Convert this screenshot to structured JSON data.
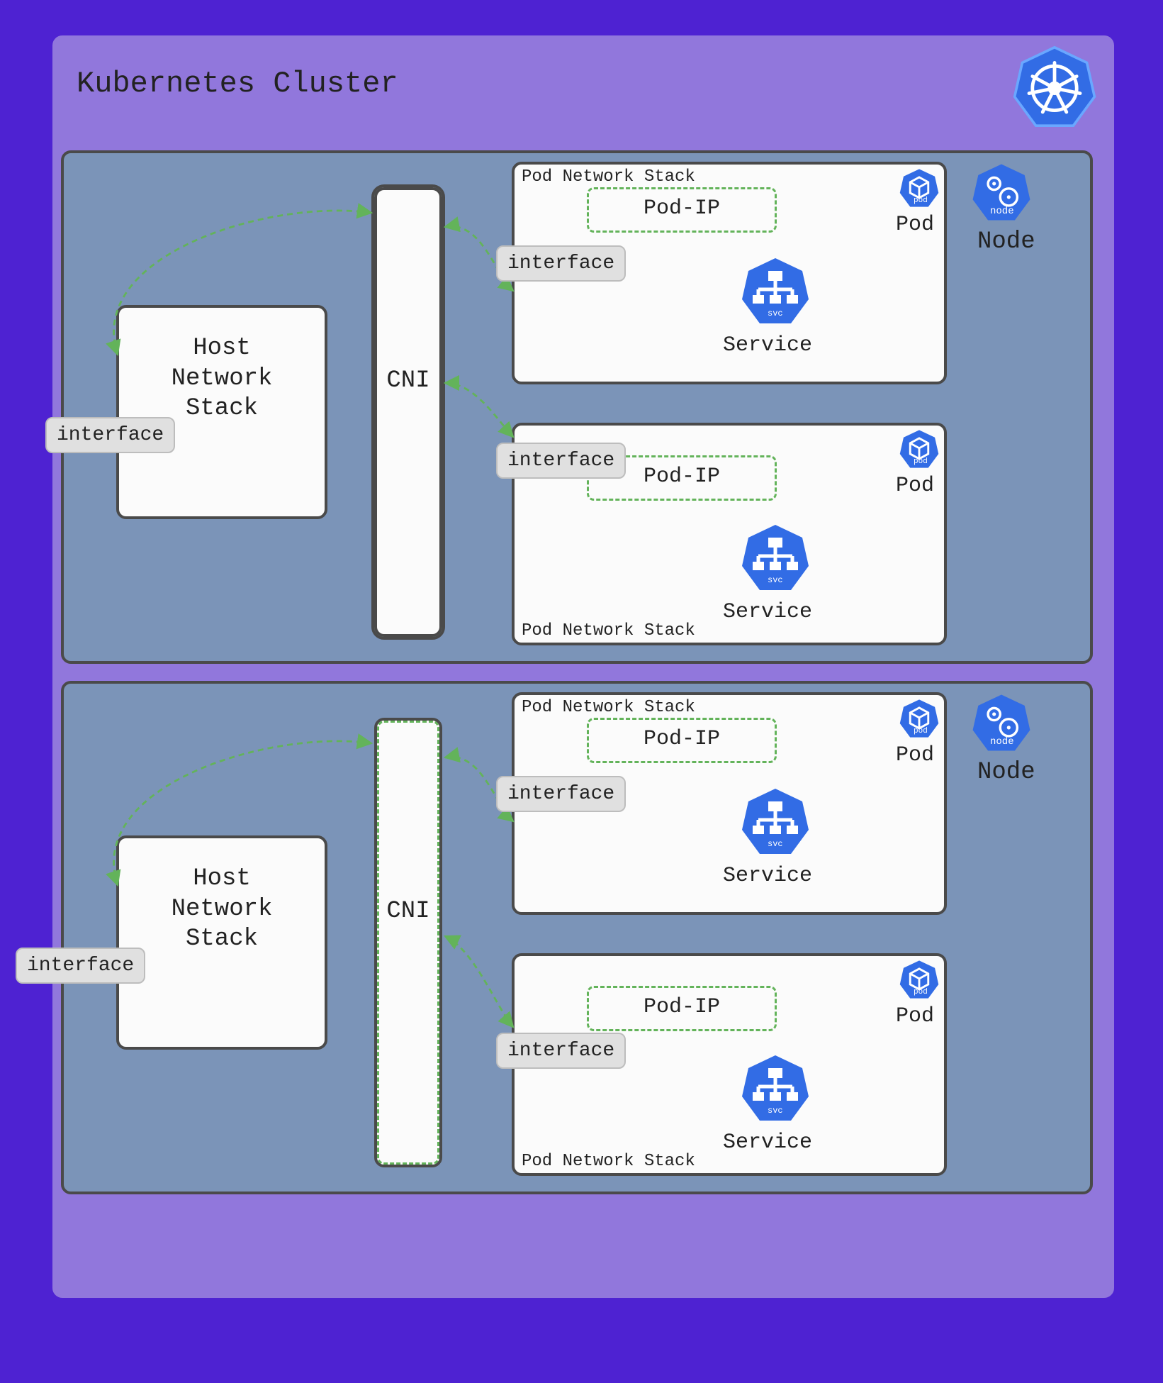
{
  "colors": {
    "bg_outer": "#4e22d2",
    "bg_cluster": "#9177dc",
    "bg_node": "#7b94b8",
    "bg_box": "#fbfbfb",
    "border": "#4a4a4a",
    "green": "#63b35a",
    "chip_bg": "#e0e0e0",
    "k8s_blue": "#326ce5"
  },
  "cluster": {
    "title": "Kubernetes Cluster"
  },
  "node": {
    "label": "Node",
    "icon_caption": "node"
  },
  "host_stack": {
    "line1": "Host",
    "line2": "Network",
    "line3": "Stack"
  },
  "cni": {
    "label": "CNI"
  },
  "pod_stack": {
    "label": "Pod Network Stack"
  },
  "pod": {
    "label": "Pod",
    "ip_label": "Pod-IP",
    "icon_caption": "pod"
  },
  "service": {
    "label": "Service",
    "icon_caption": "svc"
  },
  "interface": {
    "label": "interface"
  }
}
